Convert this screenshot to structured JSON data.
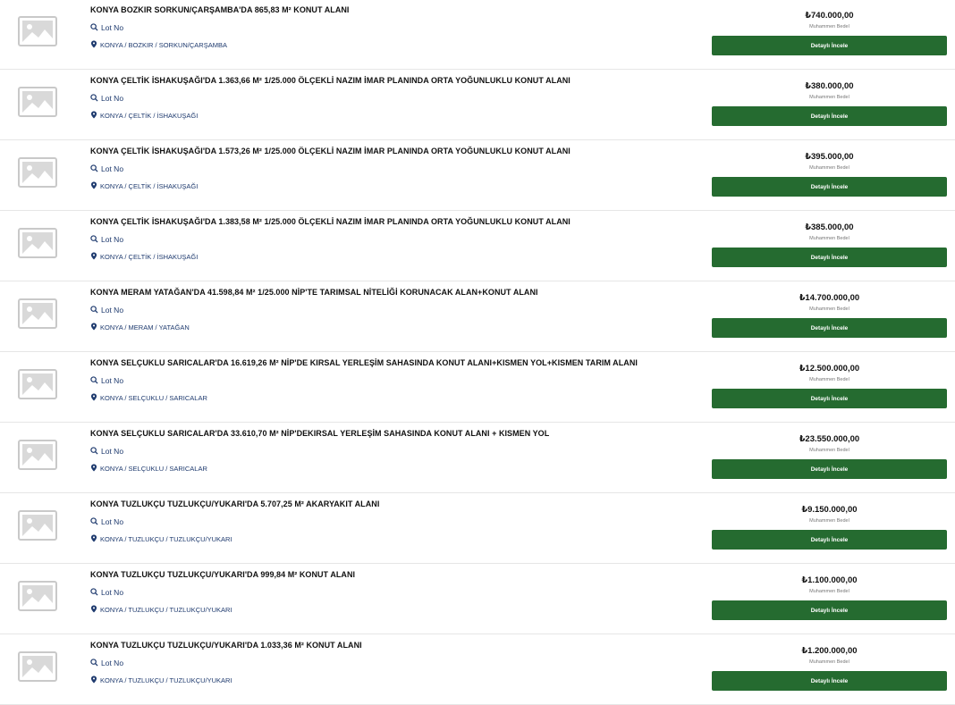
{
  "currency_symbol": "₺",
  "listings": [
    {
      "title": "KONYA BOZKIR SORKUN/ÇARŞAMBA'DA 865,83 M² KONUT ALANI",
      "lot": "Lot No",
      "location": "KONYA / BOZKIR / SORKUN/ÇARŞAMBA",
      "price": "₺740.000,00",
      "price_label": "Muhammen Bedel",
      "button": "Detaylı İncele"
    },
    {
      "title": "KONYA ÇELTİK İSHAKUŞAĞI'DA 1.363,66 M² 1/25.000 ÖLÇEKLİ NAZIM İMAR PLANINDA ORTA YOĞUNLUKLU KONUT ALANI",
      "lot": "Lot No",
      "location": "KONYA / ÇELTİK / İSHAKUŞAĞI",
      "price": "₺380.000,00",
      "price_label": "Muhammen Bedel",
      "button": "Detaylı İncele"
    },
    {
      "title": "KONYA ÇELTİK İSHAKUŞAĞI'DA 1.573,26 M² 1/25.000 ÖLÇEKLİ NAZIM İMAR PLANINDA ORTA YOĞUNLUKLU KONUT ALANI",
      "lot": "Lot No",
      "location": "KONYA / ÇELTİK / İSHAKUŞAĞI",
      "price": "₺395.000,00",
      "price_label": "Muhammen Bedel",
      "button": "Detaylı İncele"
    },
    {
      "title": "KONYA ÇELTİK İSHAKUŞAĞI'DA 1.383,58 M² 1/25.000 ÖLÇEKLİ NAZIM İMAR PLANINDA ORTA YOĞUNLUKLU KONUT ALANI",
      "lot": "Lot No",
      "location": "KONYA / ÇELTİK / İSHAKUŞAĞI",
      "price": "₺385.000,00",
      "price_label": "Muhammen Bedel",
      "button": "Detaylı İncele"
    },
    {
      "title": "KONYA MERAM YATAĞAN'DA 41.598,84 M² 1/25.000 NİP'TE TARIMSAL NİTELİĞİ KORUNACAK ALAN+KONUT ALANI",
      "lot": "Lot No",
      "location": "KONYA / MERAM / YATAĞAN",
      "price": "₺14.700.000,00",
      "price_label": "Muhammen Bedel",
      "button": "Detaylı İncele"
    },
    {
      "title": "KONYA SELÇUKLU SARICALAR'DA 16.619,26 M² NİP'DE KIRSAL YERLEŞİM SAHASINDA KONUT ALANI+KISMEN YOL+KISMEN TARIM ALANI",
      "lot": "Lot No",
      "location": "KONYA / SELÇUKLU / SARICALAR",
      "price": "₺12.500.000,00",
      "price_label": "Muhammen Bedel",
      "button": "Detaylı İncele"
    },
    {
      "title": "KONYA SELÇUKLU SARICALAR'DA 33.610,70 M² NİP'DEKIRSAL YERLEŞİM SAHASINDA KONUT ALANI + KISMEN YOL",
      "lot": "Lot No",
      "location": "KONYA / SELÇUKLU / SARICALAR",
      "price": "₺23.550.000,00",
      "price_label": "Muhammen Bedel",
      "button": "Detaylı İncele"
    },
    {
      "title": "KONYA TUZLUKÇU TUZLUKÇU/YUKARI'DA 5.707,25 M² AKARYAKIT ALANI",
      "lot": "Lot No",
      "location": "KONYA / TUZLUKÇU / TUZLUKÇU/YUKARI",
      "price": "₺9.150.000,00",
      "price_label": "Muhammen Bedel",
      "button": "Detaylı İncele"
    },
    {
      "title": "KONYA TUZLUKÇU TUZLUKÇU/YUKARI'DA 999,84 M² KONUT ALANI",
      "lot": "Lot No",
      "location": "KONYA / TUZLUKÇU / TUZLUKÇU/YUKARI",
      "price": "₺1.100.000,00",
      "price_label": "Muhammen Bedel",
      "button": "Detaylı İncele"
    },
    {
      "title": "KONYA TUZLUKÇU TUZLUKÇU/YUKARI'DA 1.033,36 M² KONUT ALANI",
      "lot": "Lot No",
      "location": "KONYA / TUZLUKÇU / TUZLUKÇU/YUKARI",
      "price": "₺1.200.000,00",
      "price_label": "Muhammen Bedel",
      "button": "Detaylı İncele"
    }
  ],
  "icons": {
    "thumbnail": "image-placeholder-icon",
    "lot": "search-icon",
    "location": "map-pin-icon"
  },
  "colors": {
    "button": "#256b30",
    "link_text": "#1e3a6e"
  }
}
